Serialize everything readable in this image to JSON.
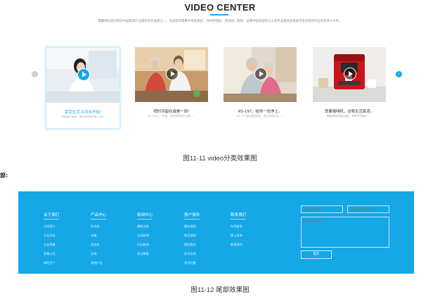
{
  "video_center": {
    "title": "VIDEO CENTER",
    "description": "慧聚相信成为目前中国家电行业最知名的品牌之一，先后获得慧聚中央电视台，《财经时报》、新浪网、网易、品牌中国等国内几十家专业媒体及权威评定机构所评出的各项十大奖。",
    "prev_icon": "chevron-left-icon",
    "next_icon": "chevron-right-icon",
    "cards": [
      {
        "title": "享受生活,从饮水开始!",
        "subtitle": "可固治疗净化，净化水质保护身，身心",
        "image": "woman-drinking-water-photo"
      },
      {
        "title": "把时间留在最美一刻!",
        "subtitle": "RS-105二门冰箱，给家里带来好心情……",
        "image": "elderly-couple-kitchen-photo"
      },
      {
        "title": "RS-197，给你一份净土。",
        "subtitle": "RS-197采用金属质感，提升家居生活……",
        "image": "elderly-couple-sofa-photo"
      },
      {
        "title": "慧聚咖啡机，诠释生活真谛。",
        "subtitle": "慧聚咖啡机精品品质，尊享你的香浓……",
        "image": "red-coffee-machine-photo"
      }
    ]
  },
  "caption_1": "图11-11 video分类效果图",
  "section_label": "部:",
  "footer": {
    "columns": [
      {
        "heading": "关于我们",
        "links": [
          "公司简介",
          "企业文化",
          "企业荣誉",
          "资格认证",
          "绿色生产"
        ]
      },
      {
        "heading": "产品中心",
        "links": [
          "饮水机",
          "冰箱",
          "洗衣机",
          "空调",
          "其他产品"
        ]
      },
      {
        "heading": "新闻中心",
        "links": [
          "最新动态",
          "企业新闻",
          "行业新闻",
          "热点聚集"
        ]
      },
      {
        "heading": "客户服务",
        "links": [
          "服务流程",
          "购买流程",
          "售后服务",
          "技术支持",
          "常见问题"
        ]
      },
      {
        "heading": "联系我们",
        "links": [
          "在线留言",
          "网上咨询",
          "联系我们"
        ]
      }
    ],
    "form": {
      "name_placeholder": "请输入您的姓名",
      "phone_placeholder": "请输入您的联系方式",
      "message_placeholder": "请输入您的留言",
      "submit_label": "提交"
    }
  },
  "caption_2": "图11-12 尾部效果图",
  "colors": {
    "accent": "#16a7e6",
    "footer_bg": "#16a7e6",
    "muted_btn": "#cfcfcf"
  }
}
